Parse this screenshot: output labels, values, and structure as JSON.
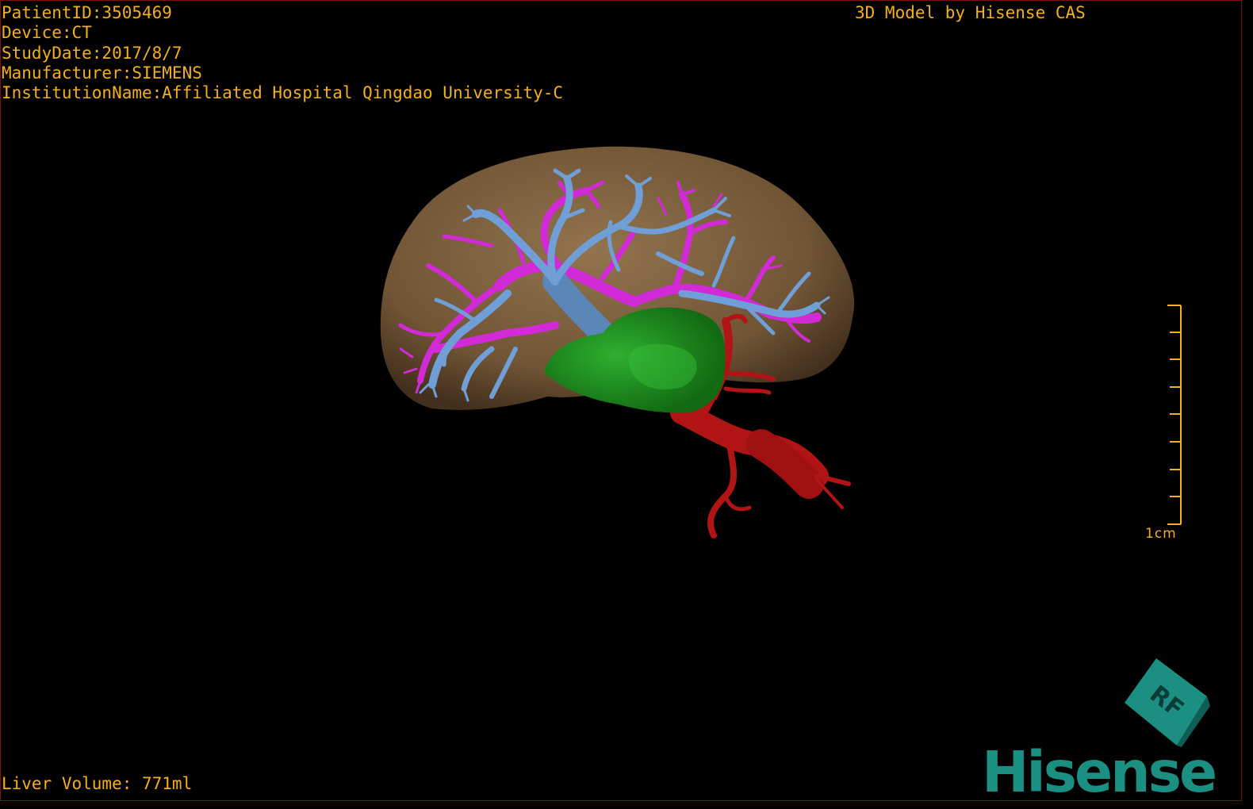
{
  "patient_info": {
    "patient_id": "PatientID:3505469",
    "device": "Device:CT",
    "study_date": "StudyDate:2017/8/7",
    "manufacturer": "Manufacturer:SIEMENS",
    "institution": "InstitutionName:Affiliated Hospital Qingdao University-C"
  },
  "credit": "3D Model by Hisense CAS",
  "liver_volume": "Liver Volume: 771ml",
  "scale_bar": {
    "label": "1cm"
  },
  "orientation_cube": {
    "face_label": "RF"
  },
  "brand": {
    "name": "Hisense"
  },
  "colors": {
    "text": "#f2b01e",
    "liver": "#8a6a45",
    "portal_vein": "#d22ad6",
    "hepatic_vein": "#6f9fd6",
    "tumor": "#1f8f1f",
    "artery": "#b01414",
    "brand": "#1a8f82"
  }
}
